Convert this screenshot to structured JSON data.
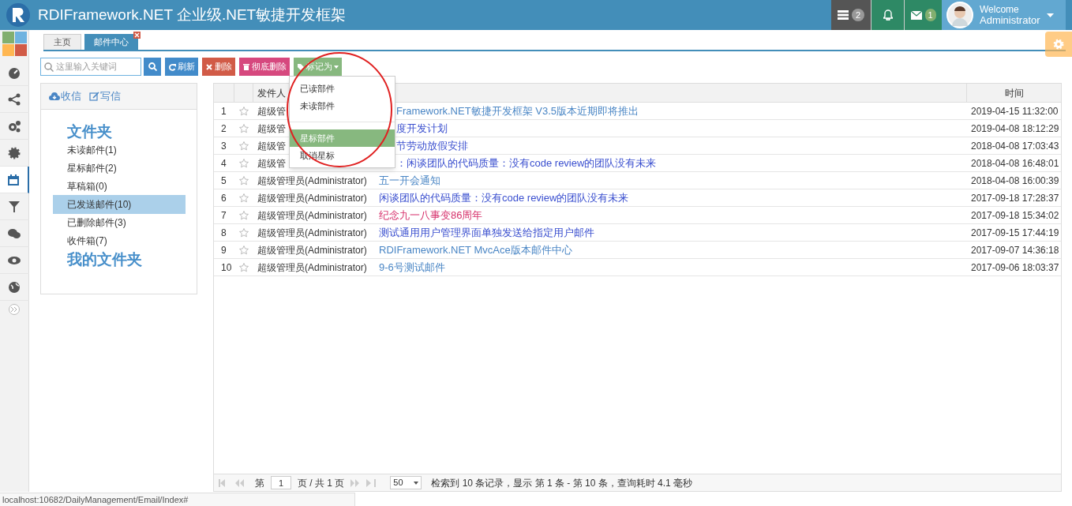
{
  "header": {
    "title": "RDIFramework.NET 企业级.NET敏捷开发框架",
    "task_badge": "2",
    "mail_badge": "1",
    "welcome": "Welcome",
    "user": "Administrator"
  },
  "sidebar": {
    "items": [
      {
        "selected": false
      },
      {
        "selected": false
      },
      {
        "selected": false
      },
      {
        "selected": false
      },
      {
        "selected": true
      },
      {
        "selected": false
      },
      {
        "selected": false
      },
      {
        "selected": false
      },
      {
        "selected": false
      }
    ]
  },
  "tabs": [
    {
      "label": "主页",
      "selected": false,
      "closable": false
    },
    {
      "label": "邮件中心",
      "selected": true,
      "closable": true
    }
  ],
  "toolbar": {
    "search_placeholder": "这里输入关键词",
    "buttons": [
      {
        "kind": "refresh",
        "label": "刷新"
      },
      {
        "kind": "delete",
        "label": "删除"
      },
      {
        "kind": "purge",
        "label": "彻底删除"
      },
      {
        "kind": "mark",
        "label": "标记为"
      }
    ]
  },
  "mark_menu": {
    "items": [
      {
        "label": "已读部件",
        "selected": false
      },
      {
        "label": "未读部件",
        "selected": false
      },
      {
        "label": "星标部件",
        "selected": true
      },
      {
        "label": "取消星标",
        "selected": false
      }
    ]
  },
  "folders": {
    "receive": "收信",
    "compose": "写信",
    "heading": "文件夹",
    "items": [
      {
        "label": "未读邮件(1)",
        "selected": false
      },
      {
        "label": "星标邮件(2)",
        "selected": false
      },
      {
        "label": "草稿箱(0)",
        "selected": false
      },
      {
        "label": "已发送邮件(10)",
        "selected": true
      },
      {
        "label": "已删除邮件(3)",
        "selected": false
      },
      {
        "label": "收件箱(7)",
        "selected": false
      }
    ],
    "my_heading": "我的文件夹"
  },
  "table": {
    "columns": [
      "发件人",
      "时间"
    ],
    "rows": [
      {
        "num": "1",
        "sender": "超级管",
        "subject": "Framework.NET敏捷开发框架 V3.5版本近期即将推出",
        "time": "2019-04-15 11:32:00",
        "covered": true,
        "color": "#4a86c5"
      },
      {
        "num": "2",
        "sender": "超级管",
        "subject": "度开发计划",
        "time": "2019-04-08 18:12:29",
        "covered": true,
        "color": "#3a4fcf"
      },
      {
        "num": "3",
        "sender": "超级管",
        "subject": "节劳动放假安排",
        "time": "2018-04-08 17:03:43",
        "covered": true,
        "color": "#3a4fcf"
      },
      {
        "num": "4",
        "sender": "超级管",
        "subject": "：闲谈团队的代码质量：没有code review的团队没有未来",
        "time": "2018-04-08 16:48:01",
        "covered": true,
        "color": "#3a4fcf"
      },
      {
        "num": "5",
        "sender": "超级管理员(Administrator)",
        "subject": "五一开会通知",
        "time": "2018-04-08 16:00:39",
        "covered": false,
        "color": "#4a86c5"
      },
      {
        "num": "6",
        "sender": "超级管理员(Administrator)",
        "subject": "闲谈团队的代码质量：没有code review的团队没有未来",
        "time": "2017-09-18 17:28:37",
        "covered": false,
        "color": "#3a4fcf"
      },
      {
        "num": "7",
        "sender": "超级管理员(Administrator)",
        "subject": "纪念九一八事变86周年",
        "time": "2017-09-18 15:34:02",
        "covered": false,
        "color": "#d6306b"
      },
      {
        "num": "8",
        "sender": "超级管理员(Administrator)",
        "subject": "测试通用用户管理界面单独发送给指定用户邮件",
        "time": "2017-09-15 17:44:19",
        "covered": false,
        "color": "#3a4fcf"
      },
      {
        "num": "9",
        "sender": "超级管理员(Administrator)",
        "subject": "RDIFramework.NET MvcAce版本邮件中心",
        "time": "2017-09-07 14:36:18",
        "covered": false,
        "color": "#4a86c5"
      },
      {
        "num": "10",
        "sender": "超级管理员(Administrator)",
        "subject": "9-6号测试邮件",
        "time": "2017-09-06 18:03:37",
        "covered": false,
        "color": "#4a86c5"
      }
    ]
  },
  "pager": {
    "page_prefix": "第",
    "page": "1",
    "page_suffix": "页 / 共 1 页",
    "page_size": "50",
    "summary": "检索到 10 条记录，显示 第 1 条 - 第 10 条，查询耗时 4.1 毫秒"
  },
  "status_url": "localhost:10682/DailyManagement/Email/Index#"
}
